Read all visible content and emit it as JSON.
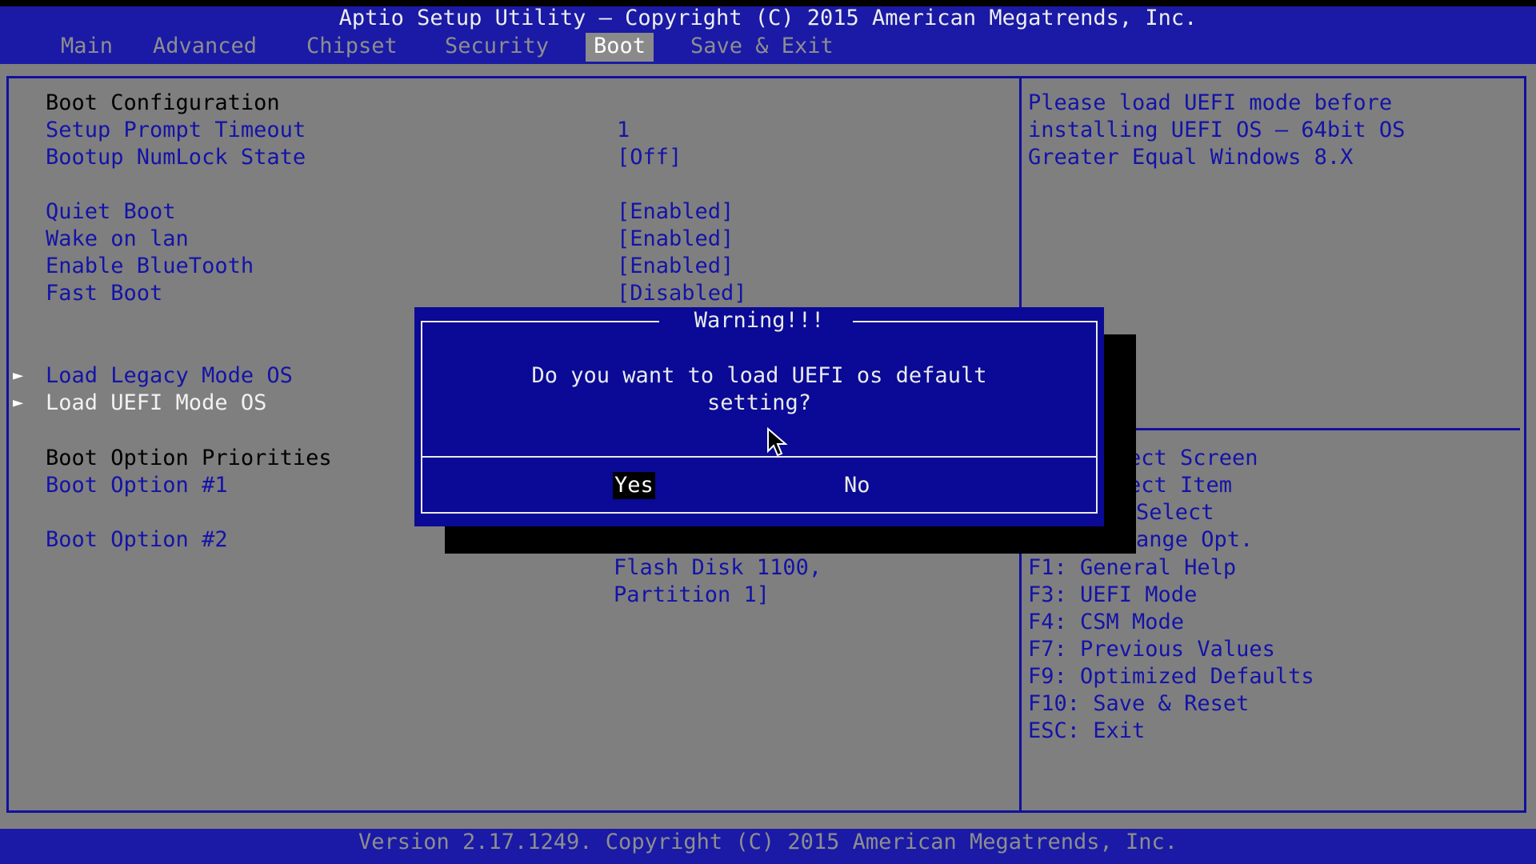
{
  "header": {
    "title": "Aptio Setup Utility – Copyright (C) 2015 American Megatrends, Inc.",
    "tabs": [
      {
        "label": "Main",
        "active": false
      },
      {
        "label": "Advanced",
        "active": false
      },
      {
        "label": "Chipset",
        "active": false
      },
      {
        "label": "Security",
        "active": false
      },
      {
        "label": "Boot",
        "active": true
      },
      {
        "label": "Save & Exit",
        "active": false
      }
    ]
  },
  "settings": {
    "section_boot_config": "Boot Configuration",
    "items": [
      {
        "label": "Setup Prompt Timeout",
        "value": "1"
      },
      {
        "label": "Bootup NumLock State",
        "value": "[Off]"
      },
      {
        "label": "Quiet Boot",
        "value": "[Enabled]"
      },
      {
        "label": "Wake on lan",
        "value": "[Enabled]"
      },
      {
        "label": "Enable BlueTooth",
        "value": "[Enabled]"
      },
      {
        "label": "Fast Boot",
        "value": "[Disabled]"
      }
    ],
    "submenus": [
      {
        "label": "Load Legacy Mode OS",
        "arrow": "►"
      },
      {
        "label": "Load UEFI Mode OS",
        "arrow": "►"
      }
    ],
    "section_priorities": "Boot Option Priorities",
    "boot_options": [
      {
        "label": "Boot Option #1"
      },
      {
        "label": "Boot Option #2"
      }
    ],
    "boot_option2_value_lines": [
      "Flash Disk 1100,",
      "Partition 1]"
    ]
  },
  "help": {
    "description_lines": [
      "Please load UEFI mode before",
      "installing UEFI OS – 64bit OS",
      "Greater Equal Windows 8.X"
    ],
    "keys": [
      "ect Screen",
      "ect Item",
      "Select",
      "ange Opt.",
      "F1: General Help",
      "F3: UEFI Mode",
      "F4: CSM Mode",
      "F7: Previous Values",
      "F9: Optimized Defaults",
      "F10: Save & Reset",
      "ESC: Exit"
    ]
  },
  "dialog": {
    "title": "Warning!!!",
    "message_lines": [
      "Do you want to load UEFI os default",
      "setting?"
    ],
    "yes_label": "Yes",
    "no_label": "No"
  },
  "footer": {
    "text": "Version 2.17.1249. Copyright (C) 2015 American Megatrends, Inc."
  },
  "colors": {
    "bios_blue": "#1a1aa6",
    "panel_gray": "#7f7f7f",
    "dialog_blue": "#0a0a96"
  }
}
